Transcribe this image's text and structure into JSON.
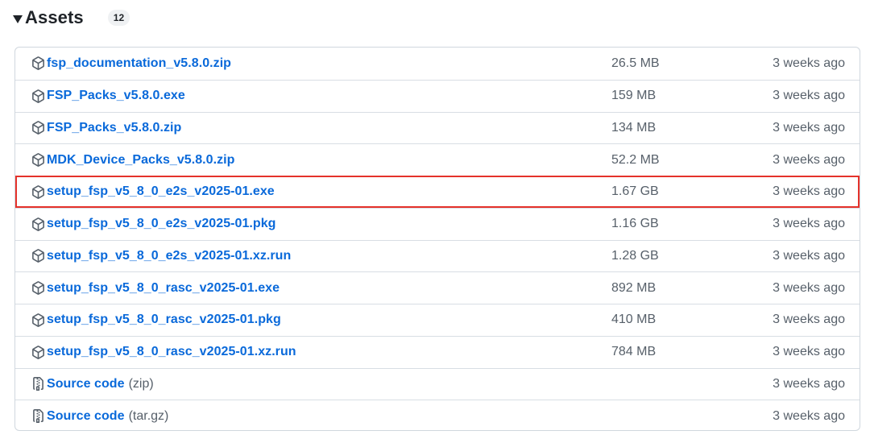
{
  "header": {
    "title": "Assets",
    "count": "12"
  },
  "assets": [
    {
      "name": "fsp_documentation_v5.8.0.zip",
      "suffix": "",
      "size": "26.5 MB",
      "date": "3 weeks ago",
      "icon": "package-icon"
    },
    {
      "name": "FSP_Packs_v5.8.0.exe",
      "suffix": "",
      "size": "159 MB",
      "date": "3 weeks ago",
      "icon": "package-icon"
    },
    {
      "name": "FSP_Packs_v5.8.0.zip",
      "suffix": "",
      "size": "134 MB",
      "date": "3 weeks ago",
      "icon": "package-icon"
    },
    {
      "name": "MDK_Device_Packs_v5.8.0.zip",
      "suffix": "",
      "size": "52.2 MB",
      "date": "3 weeks ago",
      "icon": "package-icon"
    },
    {
      "name": "setup_fsp_v5_8_0_e2s_v2025-01.exe",
      "suffix": "",
      "size": "1.67 GB",
      "date": "3 weeks ago",
      "icon": "package-icon",
      "highlighted": true
    },
    {
      "name": "setup_fsp_v5_8_0_e2s_v2025-01.pkg",
      "suffix": "",
      "size": "1.16 GB",
      "date": "3 weeks ago",
      "icon": "package-icon"
    },
    {
      "name": "setup_fsp_v5_8_0_e2s_v2025-01.xz.run",
      "suffix": "",
      "size": "1.28 GB",
      "date": "3 weeks ago",
      "icon": "package-icon"
    },
    {
      "name": "setup_fsp_v5_8_0_rasc_v2025-01.exe",
      "suffix": "",
      "size": "892 MB",
      "date": "3 weeks ago",
      "icon": "package-icon"
    },
    {
      "name": "setup_fsp_v5_8_0_rasc_v2025-01.pkg",
      "suffix": "",
      "size": "410 MB",
      "date": "3 weeks ago",
      "icon": "package-icon"
    },
    {
      "name": "setup_fsp_v5_8_0_rasc_v2025-01.xz.run",
      "suffix": "",
      "size": "784 MB",
      "date": "3 weeks ago",
      "icon": "package-icon"
    },
    {
      "name": "Source code",
      "suffix": "(zip)",
      "size": "",
      "date": "3 weeks ago",
      "icon": "file-zip-icon"
    },
    {
      "name": "Source code",
      "suffix": "(tar.gz)",
      "size": "",
      "date": "3 weeks ago",
      "icon": "file-zip-icon"
    }
  ],
  "colors": {
    "link": "#0969da",
    "muted": "#57606a",
    "highlight": "#e5322b",
    "border": "#d0d7de"
  }
}
